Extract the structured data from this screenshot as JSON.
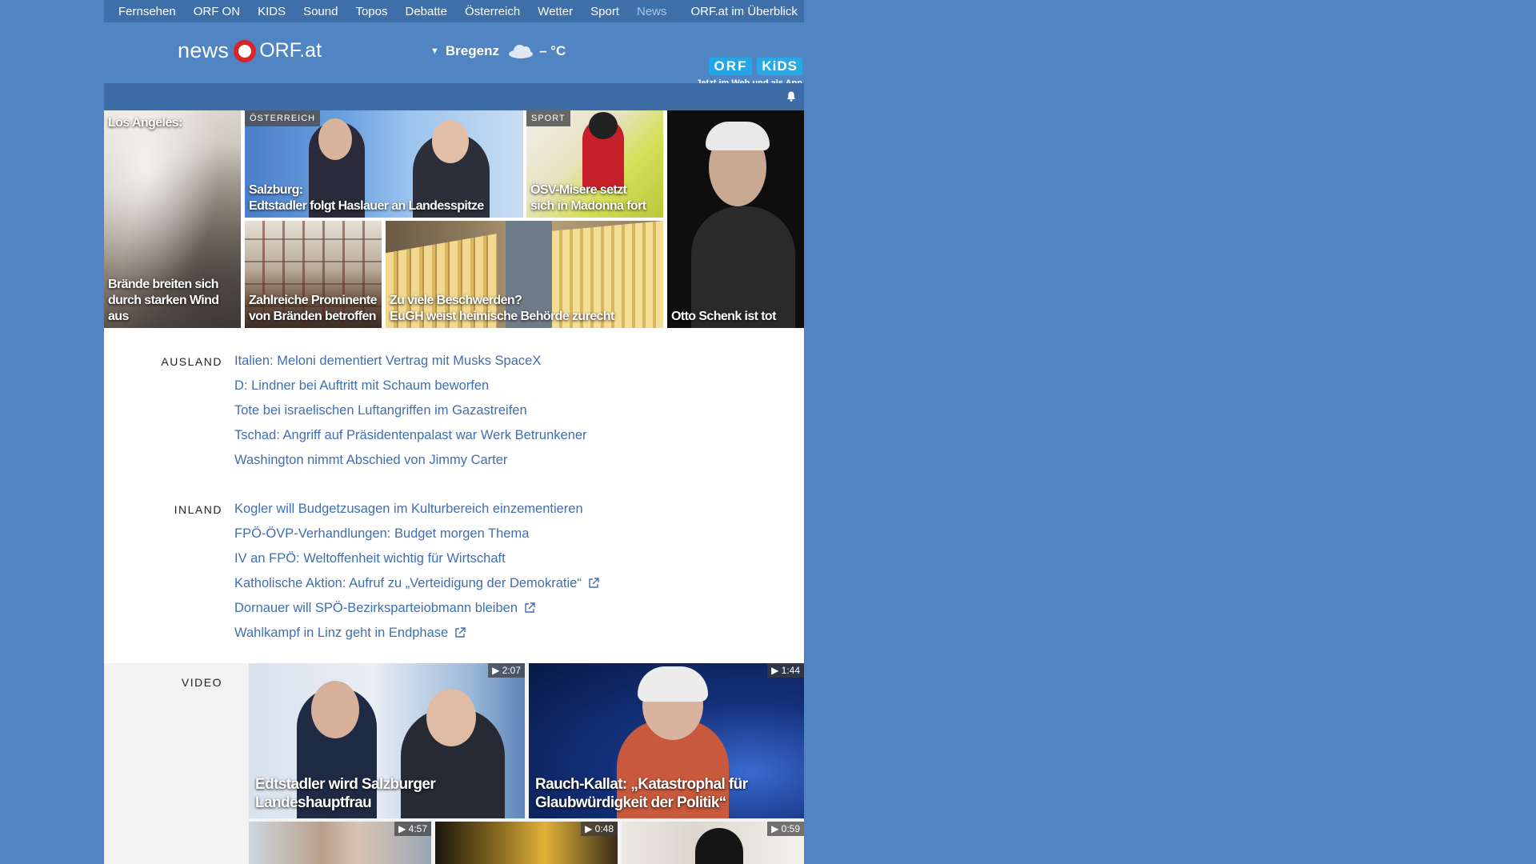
{
  "topnav": {
    "items": [
      "Fernsehen",
      "ORF ON",
      "KIDS",
      "Sound",
      "Topos",
      "Debatte",
      "Österreich",
      "Wetter",
      "Sport",
      "News"
    ],
    "overview": "ORF.at im Überblick"
  },
  "header": {
    "logo_news": "news",
    "logo_orfat": "ORF.at",
    "weather_location": "Bregenz",
    "weather_temp": "– °C",
    "kids_badge_orf": "ORF",
    "kids_badge_kids": "KiDS",
    "kids_tagline": "Jetzt im Web und als App"
  },
  "teasers": {
    "la_top": "Los Angeles:",
    "la_bottom": "Brände breiten sich durch starken Wind aus",
    "salzburg_section": "ÖSTERREICH",
    "salzburg_line1": "Salzburg:",
    "salzburg_line2": "Edtstadler folgt Haslauer an Landesspitze",
    "sport_section": "SPORT",
    "sport_line1": "ÖSV-Misere setzt",
    "sport_line2": "sich in Madonna fort",
    "prominent_line1": "Zahlreiche Prominente",
    "prominent_line2": "von Bränden betroffen",
    "eugh_line1": "Zu viele Beschwerden?",
    "eugh_line2": "EuGH weist heimische Behörde zurecht",
    "schenk": "Otto Schenk ist tot"
  },
  "ausland": {
    "label": "AUSLAND",
    "items": [
      "Italien: Meloni dementiert Vertrag mit Musks SpaceX",
      "D: Lindner bei Auftritt mit Schaum beworfen",
      "Tote bei israelischen Luftangriffen im Gazastreifen",
      "Tschad: Angriff auf Präsidentenpalast war Werk Betrunkener",
      "Washington nimmt Abschied von Jimmy Carter"
    ]
  },
  "inland": {
    "label": "INLAND",
    "items": [
      "Kogler will Budgetzusagen im Kulturbereich einzementieren",
      "FPÖ-ÖVP-Verhandlungen: Budget morgen Thema",
      "IV an FPÖ: Weltoffenheit wichtig für Wirtschaft",
      "Katholische Aktion: Aufruf zu „Verteidigung der Demokratie“",
      "Dornauer will SPÖ-Bezirksparteiobmann bleiben",
      "Wahlkampf in Linz geht in Endphase"
    ]
  },
  "video": {
    "label": "VIDEO",
    "v1_duration": "2:07",
    "v1_title_line1": "Edtstadler wird Salzburger",
    "v1_title_line2": "Landeshauptfrau",
    "v2_duration": "1:44",
    "v2_title_line1": "Rauch-Kallat: „Katastrophal für",
    "v2_title_line2": "Glaubwürdigkeit der Politik“",
    "v3_duration": "4:57",
    "v4_duration": "0:48",
    "v5_duration": "0:59"
  }
}
